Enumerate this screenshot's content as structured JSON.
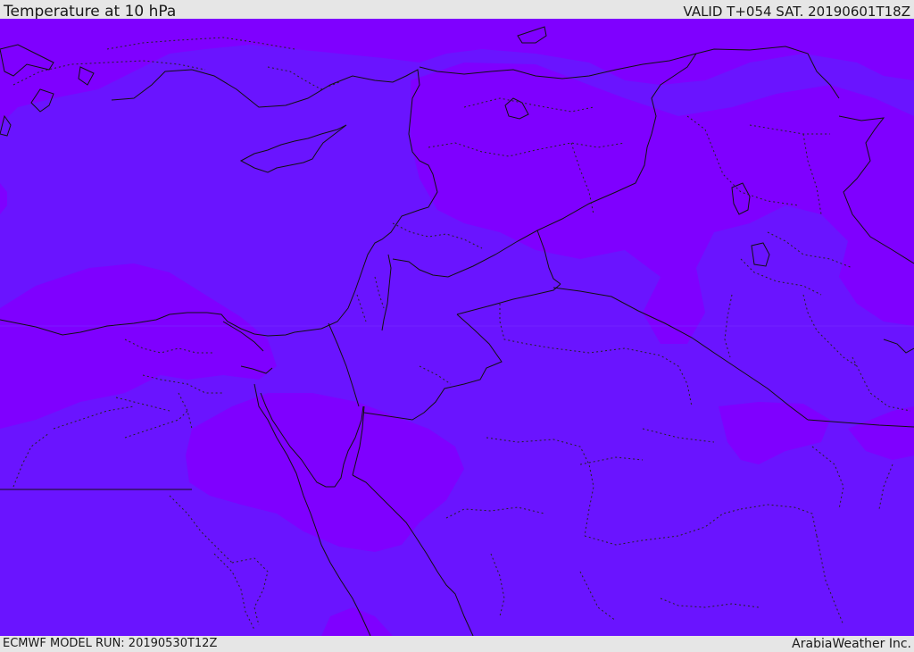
{
  "header": {
    "title": "Temperature at 10 hPa",
    "valid": "VALID T+054 SAT. 20190601T18Z"
  },
  "footer": {
    "model_run": "ECMWF MODEL RUN: 20190530T12Z",
    "credit": "ArabiaWeather Inc."
  },
  "map": {
    "colors": {
      "base": "#6a14ff",
      "warm_band": "#7f00ff",
      "lines": "#111111"
    }
  }
}
